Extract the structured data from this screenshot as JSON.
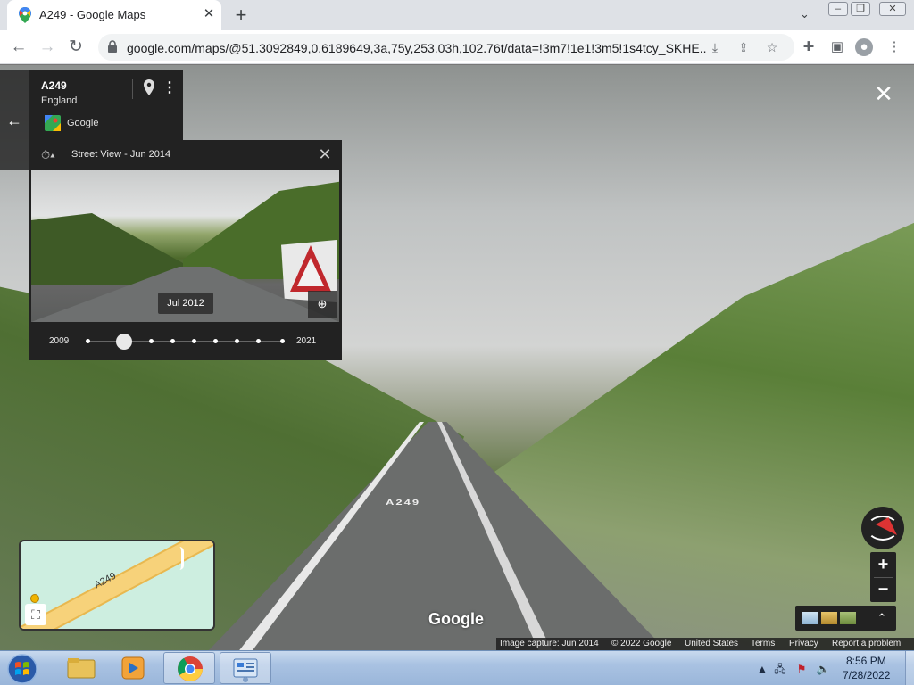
{
  "browser": {
    "tab_title": "A249 - Google Maps",
    "tab_close": "✕",
    "new_tab": "+",
    "url": "google.com/maps/@51.3092849,0.6189649,3a,75y,253.03h,102.76t/data=!3m7!1e1!3m5!1s4tcy_SKHE...",
    "icons": [
      "maps-favicon",
      "back-arrow-icon",
      "forward-arrow-icon",
      "reload-icon",
      "lock-icon",
      "install-icon",
      "share-icon",
      "bookmark-star-icon",
      "extensions-puzzle-icon",
      "side-panel-icon",
      "profile-icon",
      "kebab-menu-icon",
      "tab-search-icon"
    ]
  },
  "street_view": {
    "place_name": "A249",
    "region": "England",
    "contributor": "Google",
    "road_marking": "A249",
    "watermark": "Google"
  },
  "time_machine": {
    "title": "Street View - Jun 2014",
    "preview_date": "Jul 2012",
    "year_start": "2009",
    "year_end": "2021",
    "selected_fraction": 0.19,
    "dot_count": 10
  },
  "minimap": {
    "road_label": "A249"
  },
  "attribution": {
    "capture": "Image capture: Jun 2014",
    "copyright": "© 2022 Google",
    "country": "United States",
    "terms": "Terms",
    "privacy": "Privacy",
    "report": "Report a problem"
  },
  "controls": {
    "zoom_in": "+",
    "zoom_out": "−"
  },
  "taskbar": {
    "time": "8:56 PM",
    "date": "7/28/2022",
    "apps": [
      "file-explorer",
      "media-player",
      "chrome",
      "control-panel"
    ]
  },
  "colors": {
    "panel_bg": "#222222",
    "compass_red": "#dd3333",
    "minimap_bg": "#cdeee0",
    "road_yellow": "#f7d27a"
  }
}
